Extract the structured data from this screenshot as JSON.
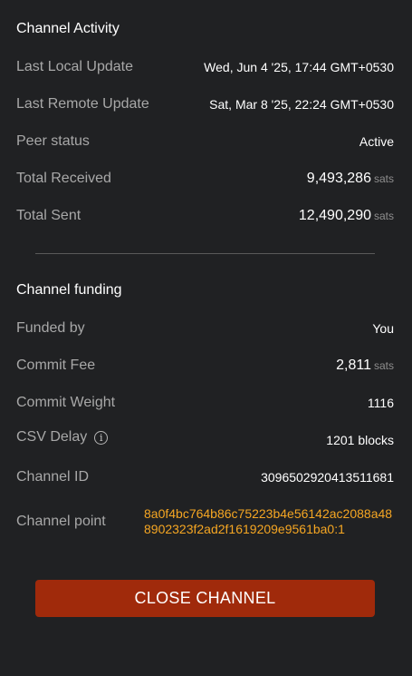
{
  "activity": {
    "title": "Channel Activity",
    "last_local_label": "Last Local Update",
    "last_local_value": "Wed, Jun 4 '25, 17:44 GMT+0530",
    "last_remote_label": "Last Remote Update",
    "last_remote_value": "Sat, Mar 8 '25, 22:24 GMT+0530",
    "peer_label": "Peer status",
    "peer_value": "Active",
    "received_label": "Total Received",
    "received_value": "9,493,286",
    "received_unit": "sats",
    "sent_label": "Total Sent",
    "sent_value": "12,490,290",
    "sent_unit": "sats"
  },
  "funding": {
    "title": "Channel funding",
    "funded_by_label": "Funded by",
    "funded_by_value": "You",
    "commit_fee_label": "Commit Fee",
    "commit_fee_value": "2,811",
    "commit_fee_unit": "sats",
    "commit_weight_label": "Commit Weight",
    "commit_weight_value": "1116",
    "csv_label": "CSV Delay",
    "csv_info_glyph": "i",
    "csv_value": "1201 blocks",
    "channel_id_label": "Channel ID",
    "channel_id_value": "3096502920413511681",
    "channel_point_label": "Channel point",
    "channel_point_value": "8a0f4bc764b86c75223b4e56142ac2088a488902323f2ad2f1619209e9561ba0:1",
    "channel_point_color": "#f5a623"
  },
  "actions": {
    "close_label": "CLOSE CHANNEL",
    "close_color": "#a02a0b"
  }
}
